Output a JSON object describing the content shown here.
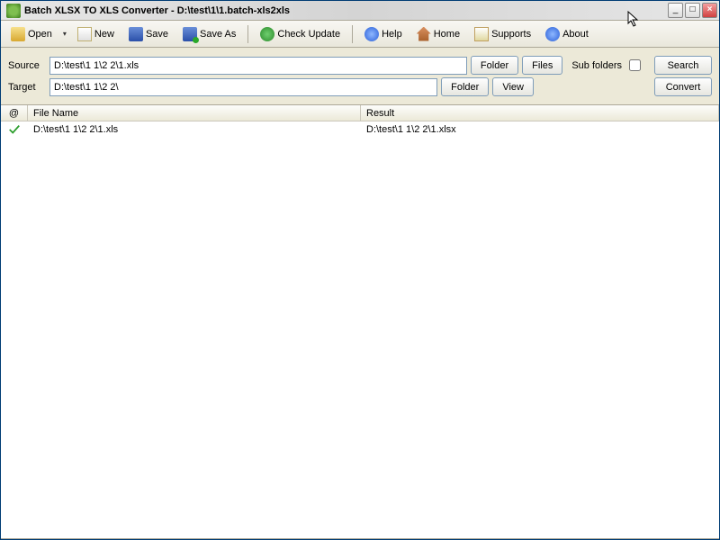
{
  "window": {
    "title": "Batch XLSX TO XLS Converter - D:\\test\\1\\1.batch-xls2xls"
  },
  "toolbar": {
    "open": "Open",
    "new": "New",
    "save": "Save",
    "save_as": "Save As",
    "check_update": "Check Update",
    "help": "Help",
    "home": "Home",
    "supports": "Supports",
    "about": "About"
  },
  "paths": {
    "source_label": "Source",
    "source_value": "D:\\test\\1 1\\2 2\\1.xls",
    "target_label": "Target",
    "target_value": "D:\\test\\1 1\\2 2\\",
    "folder_btn": "Folder",
    "files_btn": "Files",
    "view_btn": "View",
    "sub_label": "Sub folders",
    "sub_checked": false,
    "search_btn": "Search",
    "convert_btn": "Convert"
  },
  "columns": {
    "status": "@",
    "file": "File Name",
    "result": "Result"
  },
  "rows": [
    {
      "status": "ok",
      "file": "D:\\test\\1 1\\2 2\\1.xls",
      "result": "D:\\test\\1 1\\2 2\\1.xlsx"
    }
  ]
}
